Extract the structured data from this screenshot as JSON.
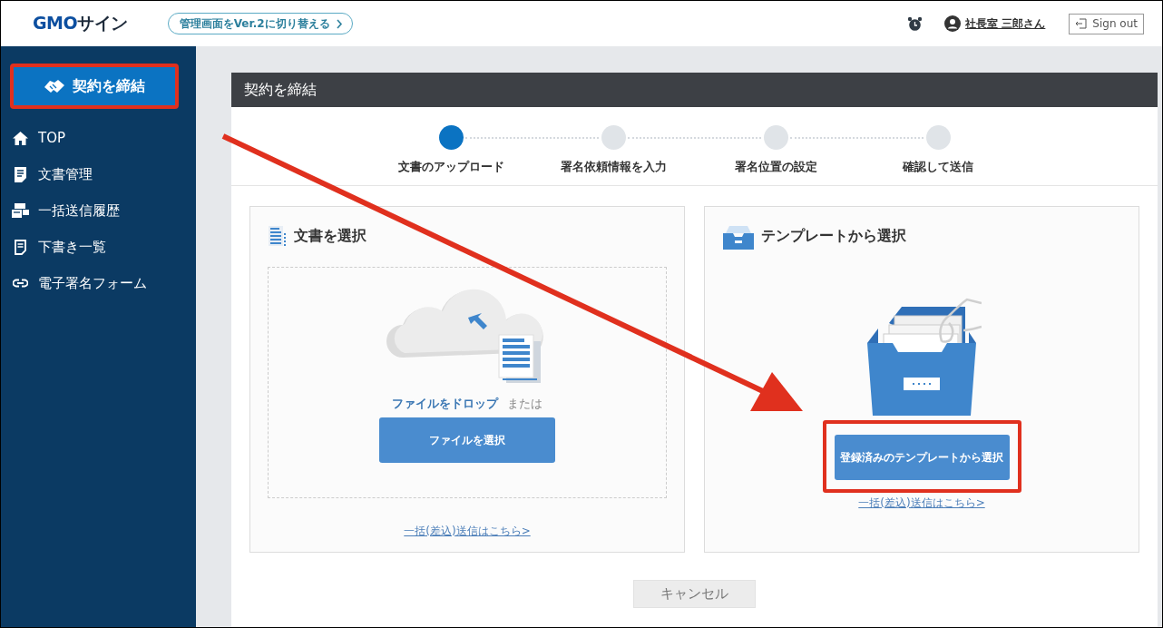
{
  "header": {
    "logo": {
      "brand": "GMO",
      "product": "サイン"
    },
    "switch_button": {
      "label": "管理画面をVer.2に切り替える"
    },
    "user": {
      "name": "社長室 三郎さん"
    },
    "sign_out": {
      "label": "Sign out"
    }
  },
  "sidebar": {
    "primary_button": {
      "label": "契約を締結",
      "highlighted": true
    },
    "items": [
      {
        "label": "TOP"
      },
      {
        "label": "文書管理"
      },
      {
        "label": "一括送信履歴"
      },
      {
        "label": "下書き一覧"
      },
      {
        "label": "電子署名フォーム"
      }
    ]
  },
  "panel": {
    "title": "契約を締結",
    "steps": [
      {
        "label": "文書のアップロード",
        "selected": true
      },
      {
        "label": "署名依頼情報を入力",
        "selected": false
      },
      {
        "label": "署名位置の設定",
        "selected": false
      },
      {
        "label": "確認して送信",
        "selected": false
      }
    ],
    "cards": [
      {
        "kind": "upload",
        "title": "文書を選択",
        "drop_text": "ファイルをドロップ",
        "or_text": "または",
        "button": {
          "label": "ファイルを選択",
          "highlighted": false
        },
        "link": "一括(差込)送信はこちら>"
      },
      {
        "kind": "template",
        "title": "テンプレートから選択",
        "button": {
          "label": "登録済みのテンプレートから選択",
          "highlighted": true
        },
        "link": "一括(差込)送信はこちら>"
      }
    ],
    "cancel_button": {
      "label": "キャンセル"
    }
  },
  "annotation": {
    "arrow": true
  }
}
